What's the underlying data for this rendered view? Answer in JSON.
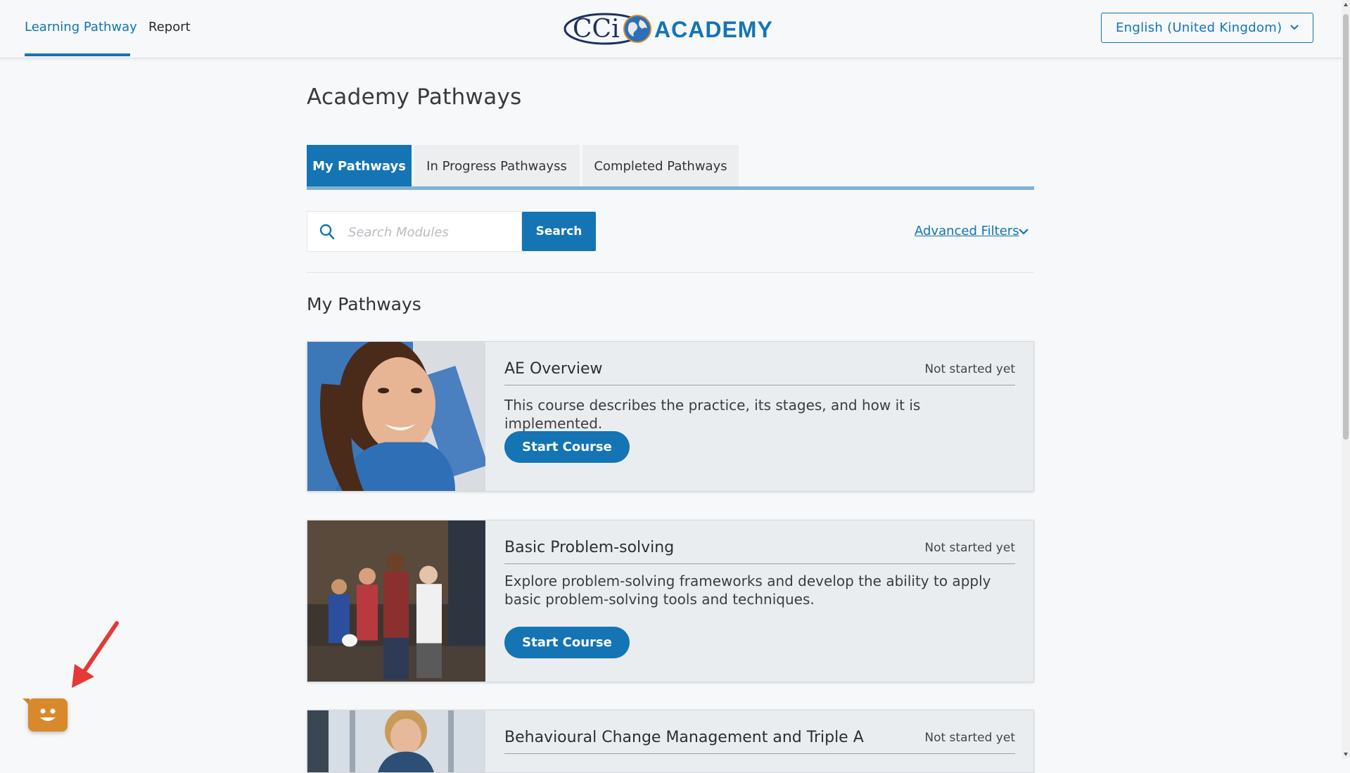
{
  "nav": {
    "items": [
      {
        "label": "Learning Pathway",
        "active": true
      },
      {
        "label": "Report",
        "active": false
      }
    ]
  },
  "logo": {
    "text_left": "CCi",
    "text_right": "ACADEMY",
    "icon": "globe-icon"
  },
  "language": {
    "selected": "English (United Kingdom)",
    "icon": "chevron-down-icon"
  },
  "page": {
    "title": "Academy Pathways"
  },
  "tabs": [
    {
      "label": "My Pathways",
      "active": true
    },
    {
      "label": "In Progress Pathwayss",
      "active": false
    },
    {
      "label": "Completed Pathways",
      "active": false
    }
  ],
  "search": {
    "placeholder": "Search Modules",
    "value": "",
    "button_label": "Search",
    "icon": "search-icon"
  },
  "filters": {
    "label": "Advanced Filters",
    "icon": "chevron-down-icon"
  },
  "section": {
    "title": "My Pathways"
  },
  "courses": [
    {
      "title": "AE Overview",
      "status": "Not started yet",
      "description": "This course describes the practice, its stages, and how it is implemented.",
      "button_label": "Start Course",
      "image": "smiling-woman-photo"
    },
    {
      "title": "Basic Problem-solving",
      "status": "Not started yet",
      "description": "Explore problem-solving frameworks and develop the ability to apply basic problem-solving tools and techniques.",
      "button_label": "Start Course",
      "image": "warehouse-team-photo"
    },
    {
      "title": "Behavioural Change Management and Triple A",
      "status": "Not started yet",
      "description": "",
      "button_label": "",
      "image": "office-woman-photo"
    }
  ],
  "colors": {
    "accent": "#1474b4",
    "background": "#f6f8f9",
    "card": "#eaedf0",
    "chat": "#d7892c",
    "annotation": "#e53935"
  }
}
